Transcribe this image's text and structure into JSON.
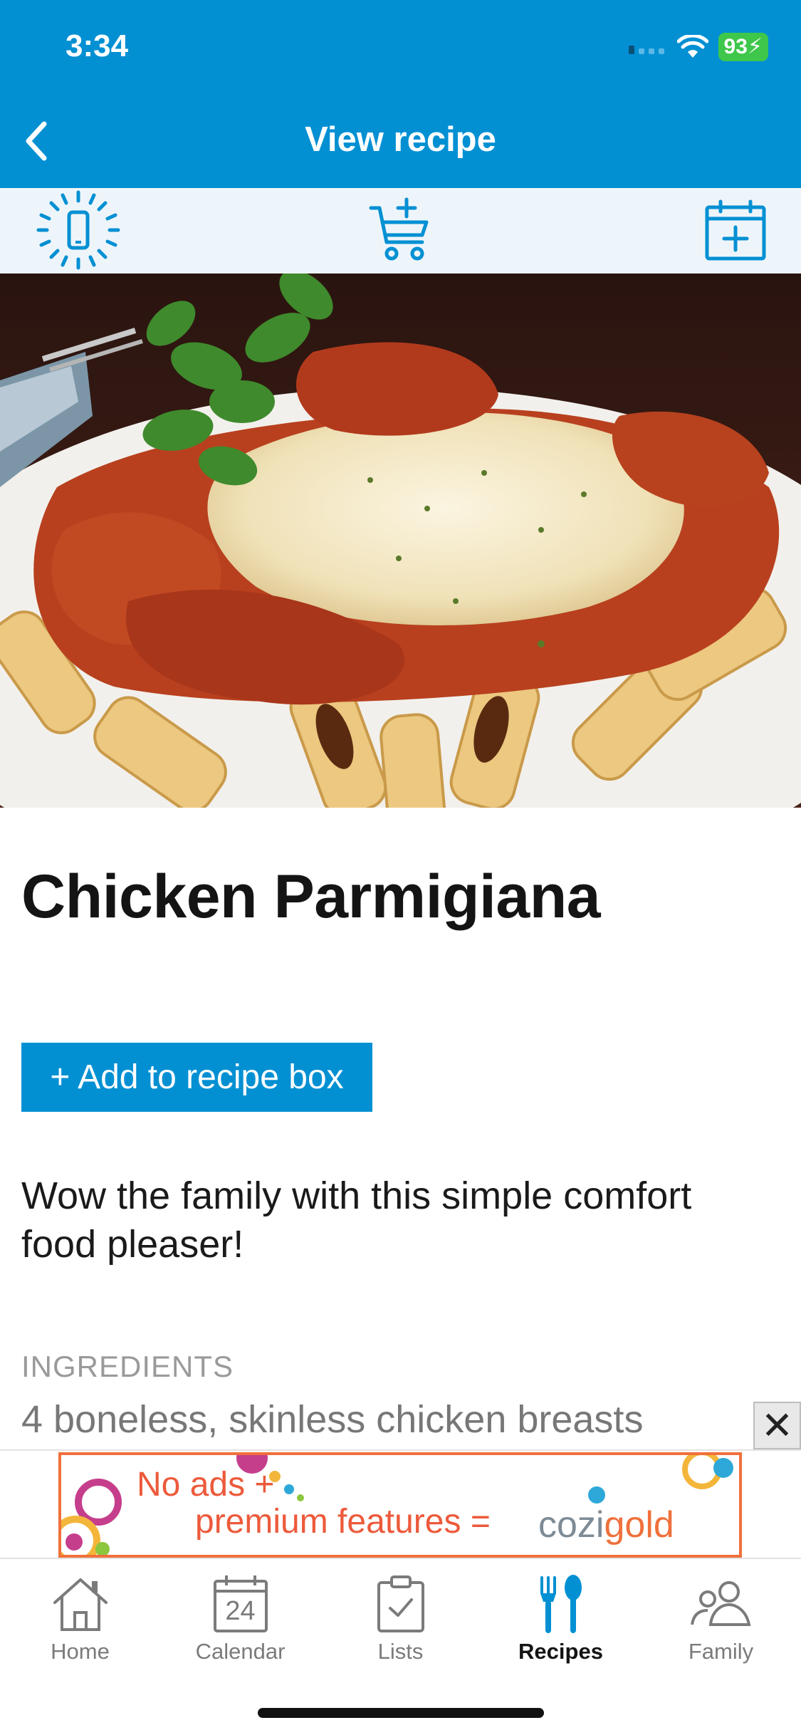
{
  "status_bar": {
    "time": "3:34",
    "battery": "93"
  },
  "header": {
    "title": "View recipe"
  },
  "toolbar": {
    "icons": [
      "screen-awake-icon",
      "add-to-cart-icon",
      "add-to-calendar-icon"
    ]
  },
  "recipe": {
    "title": "Chicken Parmigiana",
    "add_button": "+ Add to recipe box",
    "description": "Wow the family with this simple comfort food pleaser!",
    "ingredients_label": "INGREDIENTS",
    "ingredients": [
      "4 boneless, skinless chicken breasts"
    ]
  },
  "ad": {
    "line1": "No ads +",
    "line2": "premium features =",
    "brand_part1": "cozi",
    "brand_part2": "gold",
    "close": "✕"
  },
  "tabs": [
    {
      "label": "Home",
      "icon": "home-icon"
    },
    {
      "label": "Calendar",
      "icon": "calendar-icon",
      "day": "24"
    },
    {
      "label": "Lists",
      "icon": "clipboard-check-icon"
    },
    {
      "label": "Recipes",
      "icon": "fork-spoon-icon",
      "active": true
    },
    {
      "label": "Family",
      "icon": "family-icon"
    }
  ],
  "colors": {
    "brand": "#0390d3",
    "toolbar_bg": "#eef5fa",
    "battery": "#3ec74b",
    "ad_orange": "#f0703c"
  }
}
